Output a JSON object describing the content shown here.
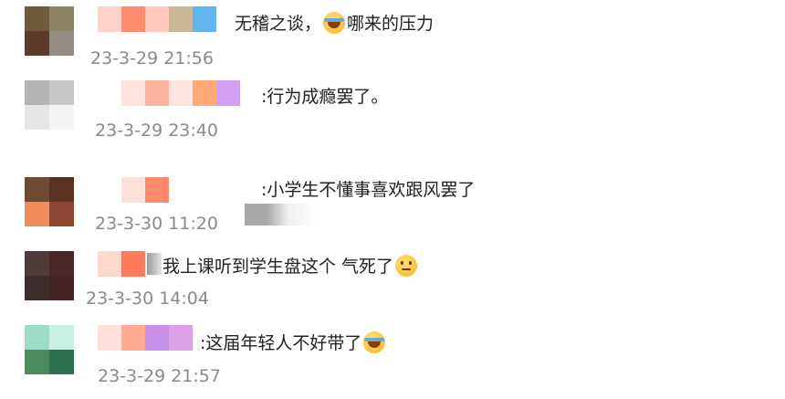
{
  "comments": [
    {
      "text_before": "无稽之谈，",
      "text_after": "哪来的压力",
      "emoji": "laughing-with-tears-icon",
      "timestamp": "23-3-29 21:56",
      "avatar_colors": [
        "#6e5a3c",
        "#8c8264",
        "#5c3a2c",
        "#948c84"
      ],
      "nick_colors": [
        "#ffd2c8",
        "#ff8c6c",
        "#ffc8be",
        "#c8b896",
        "#64b4f0"
      ]
    },
    {
      "text": ":行为成瘾罢了。",
      "timestamp": "23-3-29 23:40",
      "avatar_colors": [
        "#b4b4b4",
        "#c8c8c8",
        "#e6e6e6",
        "#f4f4f4"
      ],
      "nick_colors": [
        "#ffe4de",
        "#ffb4a0",
        "#ffe4de",
        "#ffa878",
        "#d2a0f0"
      ]
    },
    {
      "text": ":小学生不懂事喜欢跟风罢了",
      "timestamp": "23-3-30 11:20",
      "avatar_colors": [
        "#6e4a32",
        "#5a3222",
        "#f08c5a",
        "#8c4632"
      ],
      "nick_colors": [
        "#ffe0d8",
        "#ff8a6a"
      ]
    },
    {
      "text": "我上课听到学生盘这个 气死了",
      "emoji": "thinking-face-icon",
      "timestamp": "23-3-30 14:04",
      "avatar_colors": [
        "#503a3a",
        "#4a2828",
        "#3c2c2c",
        "#442424"
      ],
      "nick_colors": [
        "#ffd8cc",
        "#ff7a5a"
      ]
    },
    {
      "text": ":这届年轻人不好带了",
      "emoji": "laughing-with-tears-icon",
      "timestamp": "23-3-29 21:57",
      "avatar_colors": [
        "#9cdcc8",
        "#c8f0e4",
        "#4c8c5c",
        "#2c7050"
      ],
      "nick_colors": [
        "#ffe0d8",
        "#ffaa90",
        "#c890e8",
        "#dca0e8"
      ]
    }
  ]
}
